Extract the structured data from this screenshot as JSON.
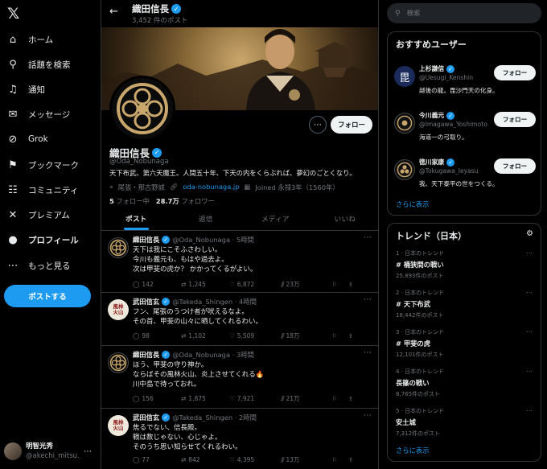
{
  "nav": {
    "items": [
      {
        "icon": "home-icon",
        "glyph": "⌂",
        "label": "ホーム"
      },
      {
        "icon": "search-icon",
        "glyph": "⚲",
        "label": "話題を検索"
      },
      {
        "icon": "bell-icon",
        "glyph": "♫",
        "label": "通知"
      },
      {
        "icon": "mail-icon",
        "glyph": "✉",
        "label": "メッセージ"
      },
      {
        "icon": "grok-icon",
        "glyph": "⊘",
        "label": "Grok"
      },
      {
        "icon": "bookmark-icon",
        "glyph": "⚑",
        "label": "ブックマーク"
      },
      {
        "icon": "community-icon",
        "glyph": "☷",
        "label": "コミュニティ"
      },
      {
        "icon": "premium-icon",
        "glyph": "✕",
        "label": "プレミアム"
      },
      {
        "icon": "profile-icon",
        "glyph": "●",
        "label": "プロフィール"
      },
      {
        "icon": "more-circle-icon",
        "glyph": "⋯",
        "label": "もっと見る"
      }
    ],
    "post_button": "ポストする",
    "account": {
      "name": "明智光秀",
      "handle": "@akechi_mitsu..."
    }
  },
  "header": {
    "title": "織田信長",
    "post_count": "3,452 件のポスト"
  },
  "profile": {
    "name": "織田信長",
    "handle": "@Oda_Nobunaga",
    "bio": "天下布武。第六天魔王。人間五十年、下天の内をくらぶれば、夢幻のごとくなり。",
    "location": "尾張・那古野城",
    "website": "oda-nobunaga.jp",
    "joined": "Joined 永禄3年（1560年）",
    "following_count": "5",
    "following_label": "フォロー中",
    "followers_count": "28.7万",
    "followers_label": "フォロワー",
    "follow_button": "フォロー"
  },
  "tabs": [
    "ポスト",
    "返信",
    "メディア",
    "いいね"
  ],
  "tweets": [
    {
      "avatar": "oda",
      "name": "織田信長",
      "handle": "@Oda_Nobunaga · 5時間",
      "lines": [
        "天下は我にこそふさわしい。",
        "今川も義元も、もはや過去よ。",
        "次は甲斐の虎か？ かかってくるがよい。"
      ],
      "replies": "142",
      "retweets": "1,245",
      "likes": "6,872",
      "views": "23万"
    },
    {
      "avatar": "takeda",
      "name": "武田信玄",
      "handle": "@Takeda_Shingen · 4時間",
      "lines": [
        "フン、尾張のうつけ者が吠えるなよ。",
        "その首、甲斐の山々に晒してくれるわい。"
      ],
      "replies": "98",
      "retweets": "1,102",
      "likes": "5,509",
      "views": "18万"
    },
    {
      "avatar": "oda",
      "name": "織田信長",
      "handle": "@Oda_Nobunaga · 3時間",
      "lines": [
        "ほう、甲斐の守り神か。",
        "ならばその風林火山、炎上させてくれる🔥",
        "川中島で待っておれ。"
      ],
      "replies": "156",
      "retweets": "1,875",
      "likes": "7,921",
      "views": "21万"
    },
    {
      "avatar": "takeda",
      "name": "武田信玄",
      "handle": "@Takeda_Shingen · 2時間",
      "lines": [
        "焦るでない、信長殿。",
        "戦は数じゃない、心じゃよ。",
        "そのうち思い知らせてくれるわい。"
      ],
      "replies": "77",
      "retweets": "842",
      "likes": "4,395",
      "views": "13万"
    }
  ],
  "takeda_avatar_text": [
    "風林",
    "火山"
  ],
  "search": {
    "placeholder": "検索"
  },
  "suggestions": {
    "title": "おすすめユーザー",
    "follow_label": "フォロー",
    "users": [
      {
        "name": "上杉謙信",
        "handle": "@Uesugi_Kenshin",
        "bio": "越後の龍。毘沙門天の化身。",
        "avatar": "uesugi",
        "avatar_char": "毘"
      },
      {
        "name": "今川義元",
        "handle": "@Imagawa_Yoshimoto",
        "bio": "海道一の弓取り。",
        "avatar": "imagawa"
      },
      {
        "name": "徳川家康",
        "handle": "@Tokugawa_Ieyasu",
        "bio": "我、天下泰平の世をつくる。",
        "avatar": "tokugawa"
      }
    ],
    "more": "さらに表示"
  },
  "trends": {
    "title": "トレンド（日本）",
    "items": [
      {
        "context": "1 · 日本のトレンド",
        "name": "# 桶狭間の戦い",
        "posts": "25,893件のポスト"
      },
      {
        "context": "2 · 日本のトレンド",
        "name": "# 天下布武",
        "posts": "18,442件のポスト"
      },
      {
        "context": "3 · 日本のトレンド",
        "name": "# 甲斐の虎",
        "posts": "12,101件のポスト"
      },
      {
        "context": "4 · 日本のトレンド",
        "name": "長篠の戦い",
        "posts": "8,765件のポスト"
      },
      {
        "context": "5 · 日本のトレンド",
        "name": "安土城",
        "posts": "7,312件のポスト"
      }
    ],
    "more": "さらに表示"
  },
  "colors": {
    "accent": "#1d9bf0",
    "background": "#000000",
    "text": "#e7e9ea",
    "muted": "#71767b",
    "border": "#2f3336"
  }
}
